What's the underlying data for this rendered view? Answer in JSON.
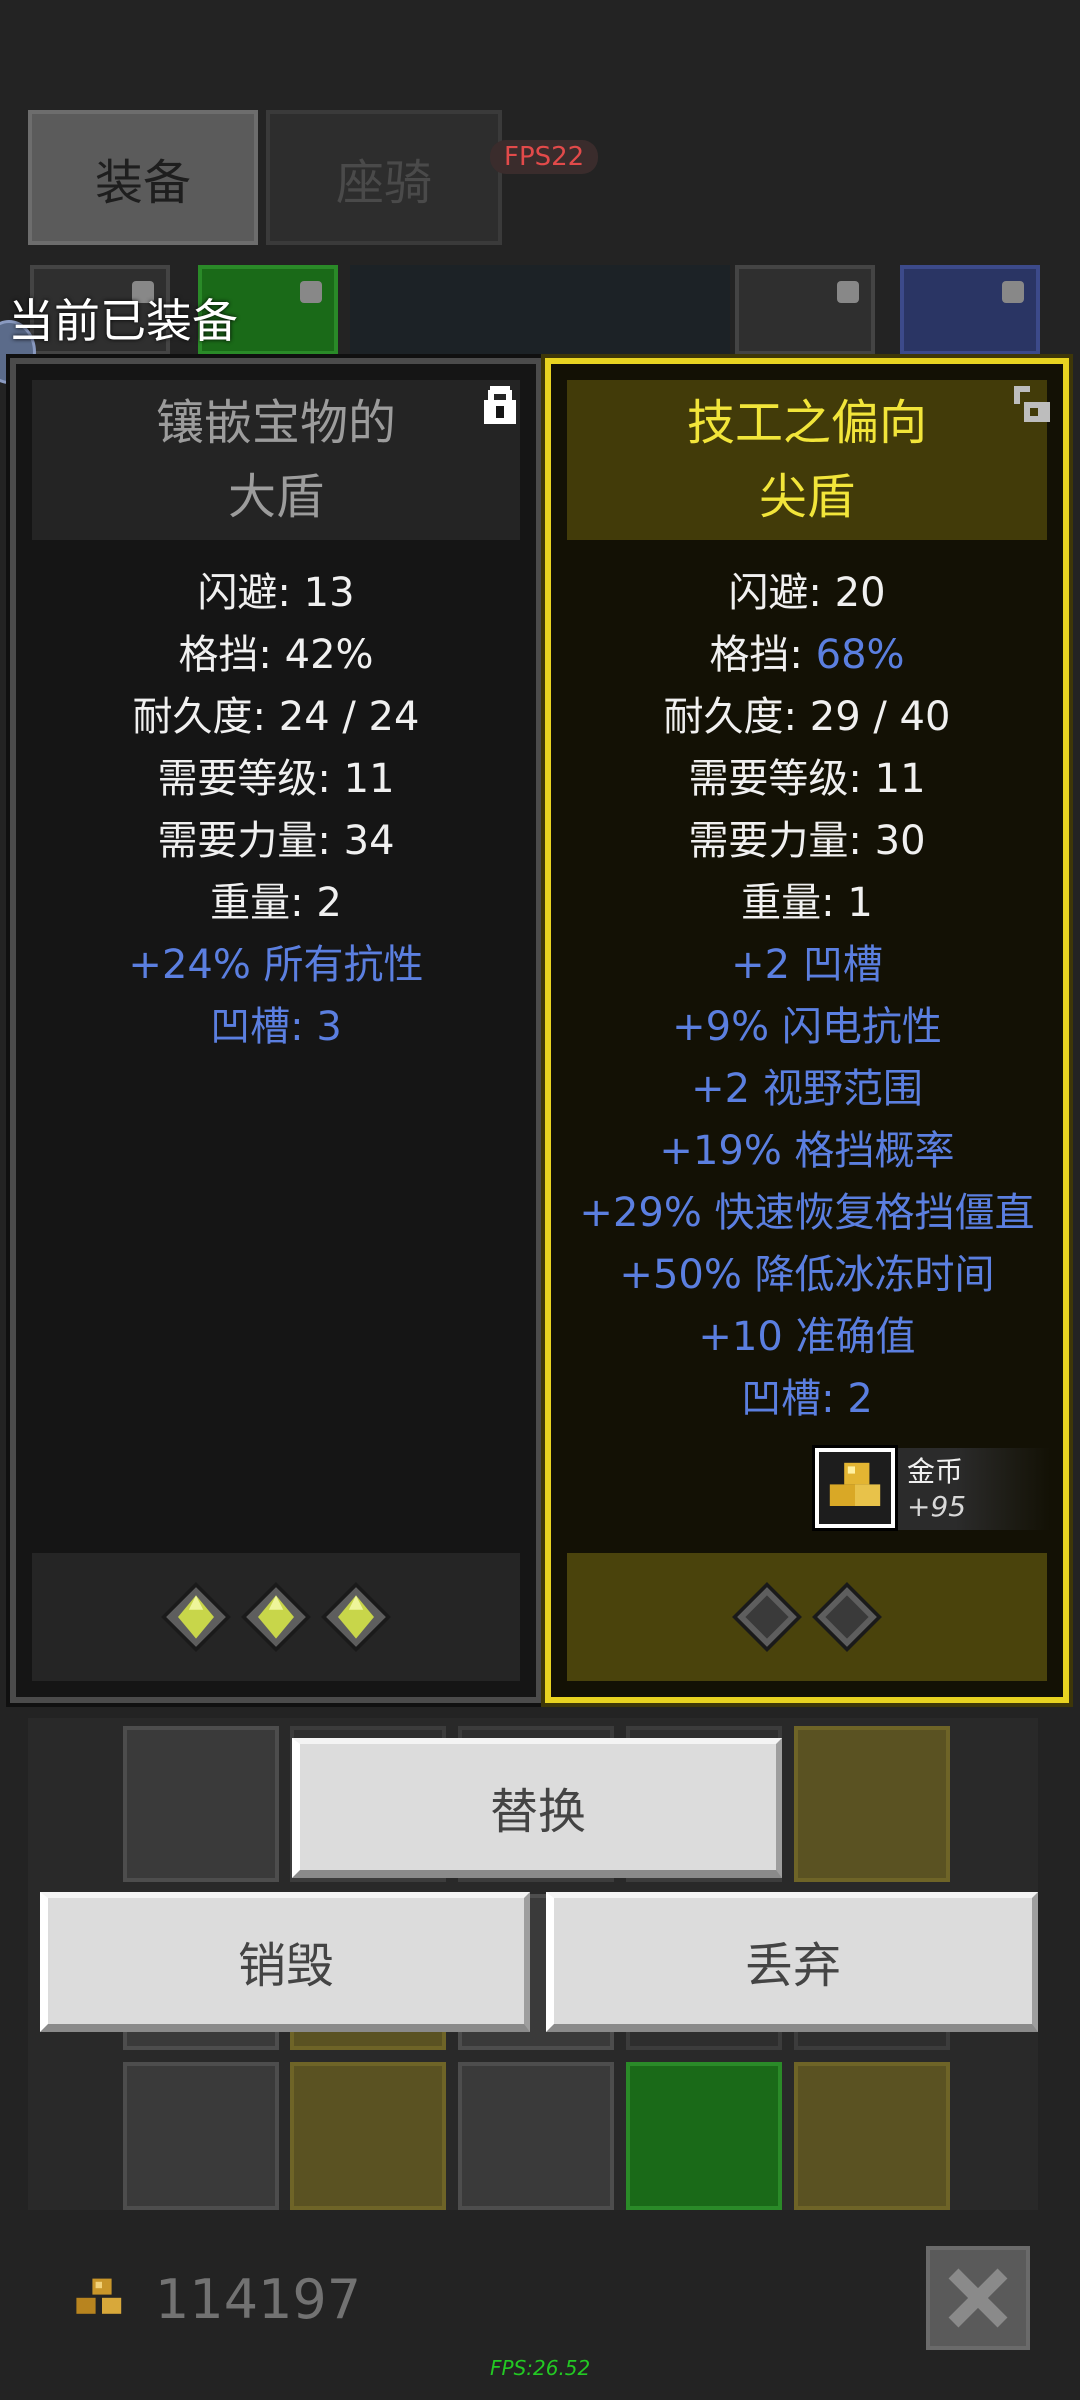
{
  "tabs": [
    {
      "label": "装备",
      "active": true
    },
    {
      "label": "座骑",
      "active": false
    }
  ],
  "fps_badge": "FPS22",
  "current_equipped_label": "当前已装备",
  "equipped_item": {
    "name_line1": "镶嵌宝物的",
    "name_line2": "大盾",
    "locked": true,
    "stats": [
      {
        "label": "闪避: ",
        "value": "13"
      },
      {
        "label": "格挡: ",
        "value": "42%"
      },
      {
        "label": "耐久度: ",
        "value": "24 / 24"
      },
      {
        "label": "需要等级: ",
        "value": "11"
      },
      {
        "label": "需要力量: ",
        "value": "34"
      },
      {
        "label": "重量: ",
        "value": "2"
      }
    ],
    "affixes": [
      "+24% 所有抗性",
      "凹槽: 3"
    ],
    "sockets_filled": 3,
    "sockets_empty": 0,
    "rarity_color": "#9c9c9c"
  },
  "compared_item": {
    "name_line1": "技工之偏向",
    "name_line2": "尖盾",
    "locked": false,
    "stats": [
      {
        "label": "闪避: ",
        "value": "20"
      },
      {
        "label": "格挡: ",
        "value": "68%"
      },
      {
        "label": "耐久度: ",
        "value": "29 / 40"
      },
      {
        "label": "需要等级: ",
        "value": "11"
      },
      {
        "label": "需要力量: ",
        "value": "30"
      },
      {
        "label": "重量: ",
        "value": "1"
      }
    ],
    "affixes": [
      "+2 凹槽",
      "+9% 闪电抗性",
      "+2 视野范围",
      "+19% 格挡概率",
      "+29% 快速恢复格挡僵直",
      "+50% 降低冰冻时间",
      "+10 准确值",
      "凹槽: 2"
    ],
    "sockets_filled": 0,
    "sockets_empty": 2,
    "rarity_color": "#f2e53a",
    "gold_value": {
      "name": "金币",
      "amount": "+95"
    }
  },
  "buttons": {
    "replace": "替换",
    "destroy": "销毁",
    "drop": "丢弃"
  },
  "gold_total": "114197",
  "fps_bottom": "FPS:26.52",
  "colors": {
    "blue_stat": "#5b7fe0",
    "unique_yellow": "#e8d321"
  }
}
